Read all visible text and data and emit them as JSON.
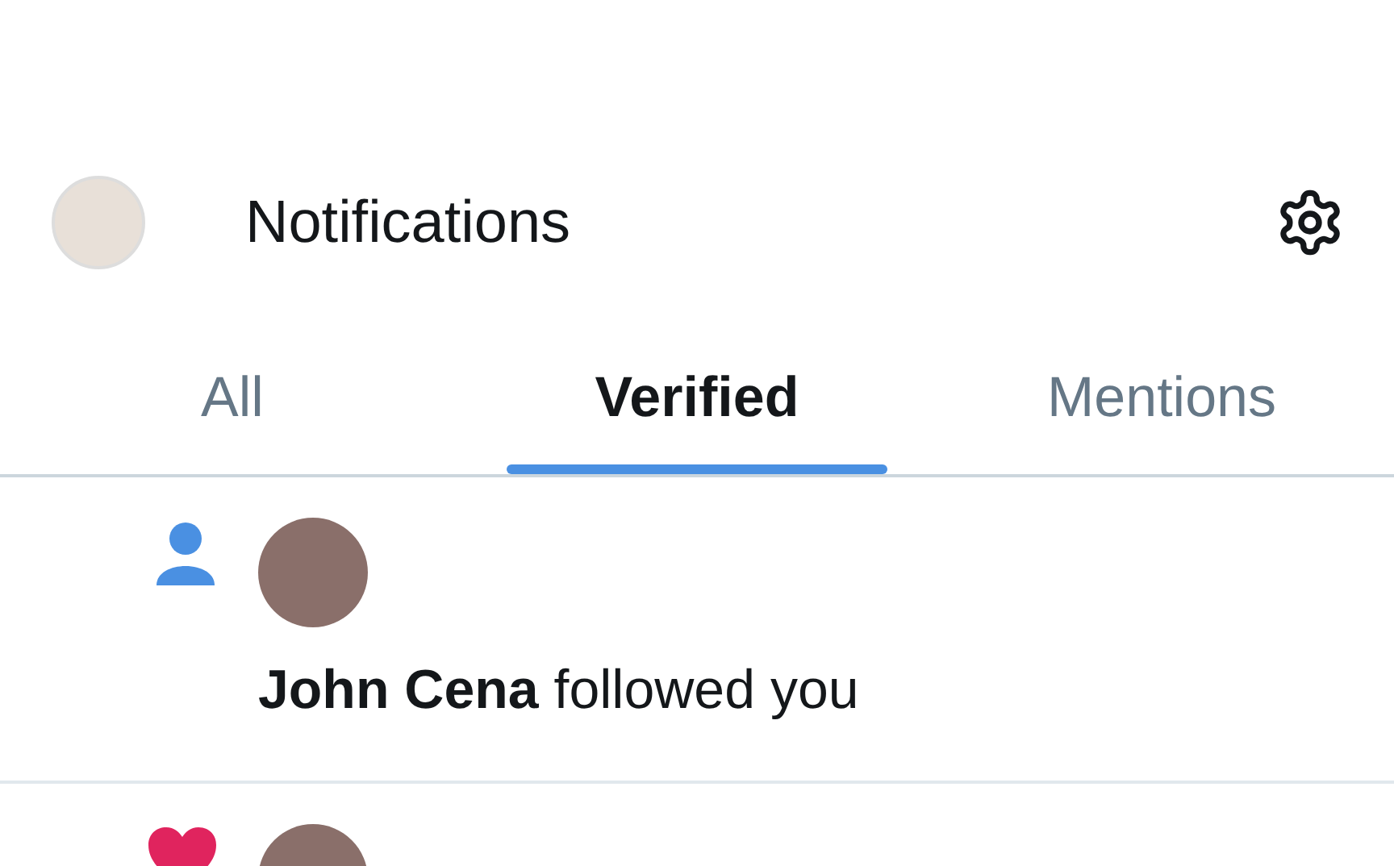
{
  "header": {
    "title": "Notifications"
  },
  "tabs": [
    {
      "label": "All",
      "selected": false
    },
    {
      "label": "Verified",
      "selected": true
    },
    {
      "label": "Mentions",
      "selected": false
    }
  ],
  "notifications": [
    {
      "kind": "follow",
      "text": "**John Cena** followed you"
    },
    {
      "kind": "like"
    }
  ]
}
